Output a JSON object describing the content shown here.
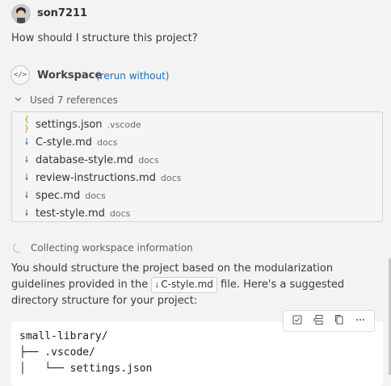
{
  "user": {
    "name": "son7211",
    "question": "How should I structure this project?"
  },
  "workspace": {
    "title": "Workspace",
    "rerun_label": "(rerun without)"
  },
  "references": {
    "toggle_label": "Used 7 references",
    "items": [
      {
        "name": "settings.json",
        "dir": ".vscode",
        "icon": "json-file-icon"
      },
      {
        "name": "C-style.md",
        "dir": "docs",
        "icon": "markdown-file-icon"
      },
      {
        "name": "database-style.md",
        "dir": "docs",
        "icon": "markdown-file-icon"
      },
      {
        "name": "review-instructions.md",
        "dir": "docs",
        "icon": "markdown-file-icon"
      },
      {
        "name": "spec.md",
        "dir": "docs",
        "icon": "markdown-file-icon"
      },
      {
        "name": "test-style.md",
        "dir": "docs",
        "icon": "markdown-file-icon"
      }
    ]
  },
  "progress": {
    "label": "Collecting workspace information"
  },
  "answer": {
    "part1": "You should structure the project based on the modularization guidelines provided in the",
    "chip": "C-style.md",
    "part2": "file. Here's a suggested directory structure for your project:"
  },
  "code": {
    "lines": [
      "small-library/",
      "├── .vscode/",
      "│   └── settings.json"
    ]
  },
  "code_toolbar": {
    "buttons": [
      "apply-in-editor-icon",
      "insert-at-cursor-icon",
      "copy-icon",
      "more-actions-icon"
    ]
  },
  "colors": {
    "link": "#1a6dc2",
    "md_icon": "#2f7ac1",
    "json_icon": "#b89500",
    "background": "#f3f3f3"
  }
}
